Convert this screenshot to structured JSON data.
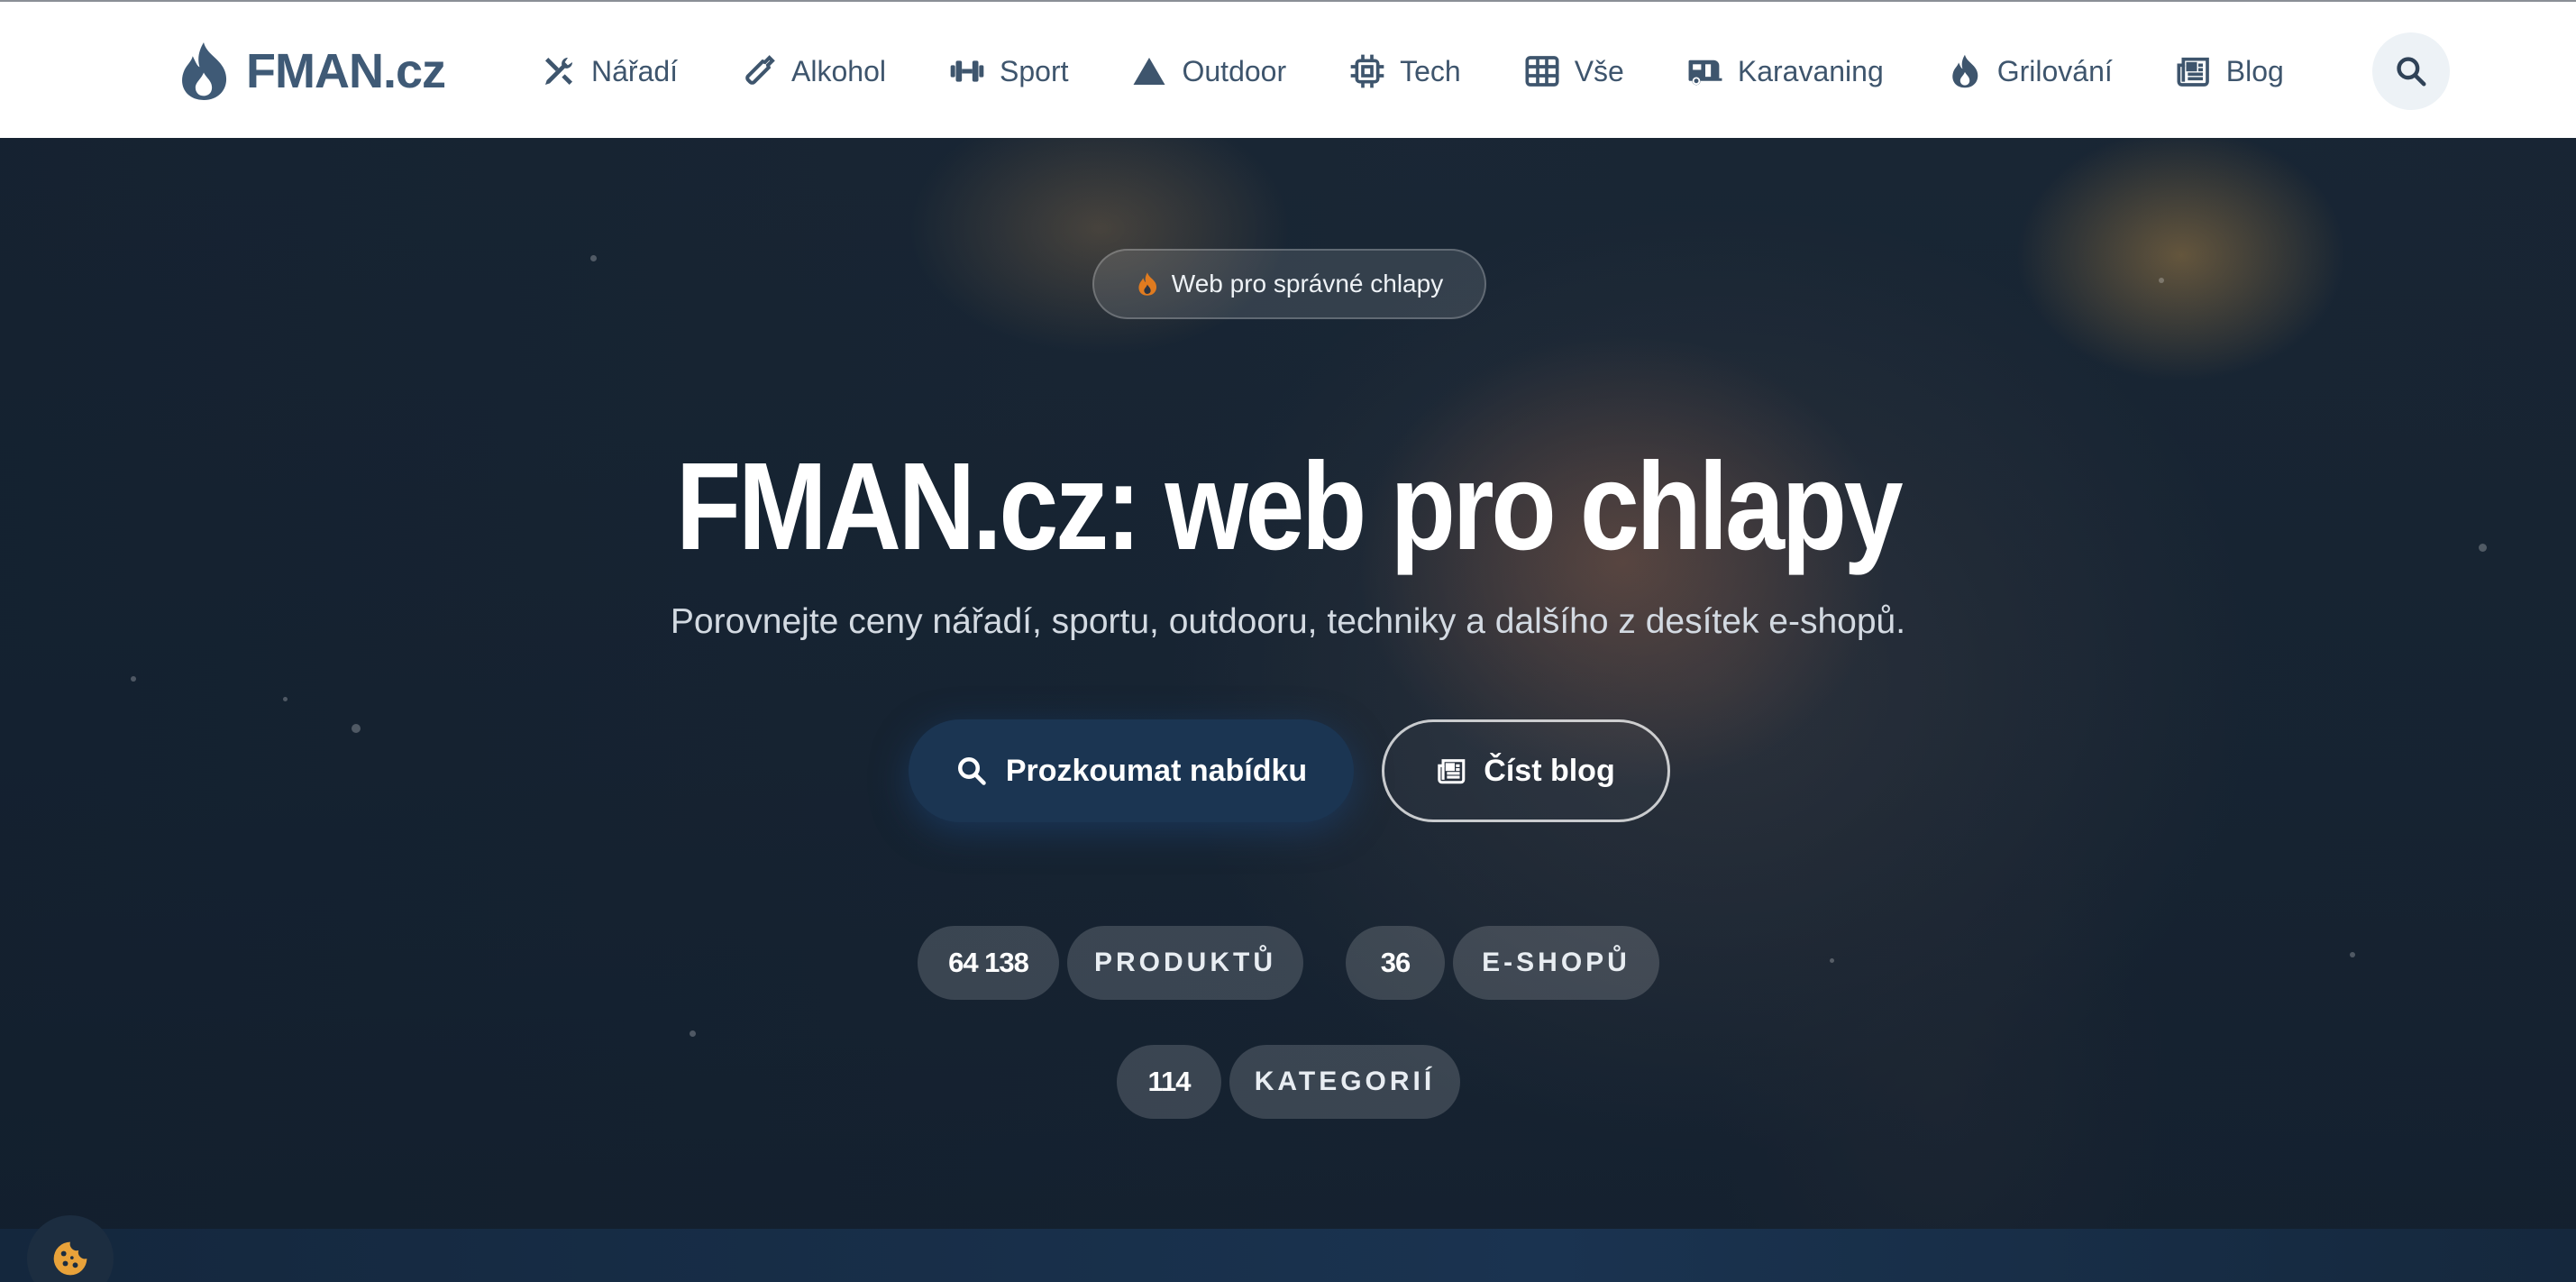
{
  "brand": {
    "name": "FMAN.cz",
    "logo_icon": "flame-icon",
    "color": "#3f5a76"
  },
  "nav": {
    "items": [
      {
        "label": "Nářadí",
        "icon": "tools-icon"
      },
      {
        "label": "Alkohol",
        "icon": "bottle-icon"
      },
      {
        "label": "Sport",
        "icon": "dumbbell-icon"
      },
      {
        "label": "Outdoor",
        "icon": "mountain-icon"
      },
      {
        "label": "Tech",
        "icon": "chip-icon"
      },
      {
        "label": "Vše",
        "icon": "grid-icon"
      },
      {
        "label": "Karavaning",
        "icon": "caravan-icon"
      },
      {
        "label": "Grilování",
        "icon": "flame-icon"
      },
      {
        "label": "Blog",
        "icon": "newspaper-icon"
      }
    ],
    "search_icon": "search-icon"
  },
  "hero": {
    "badge": "Web pro správné chlapy",
    "title": "FMAN.cz: web pro chlapy",
    "subtitle": "Porovnejte ceny nářadí, sportu, outdooru, techniky a dalšího z desítek e-shopů.",
    "primary_button": "Prozkoumat nabídku",
    "secondary_button": "Číst blog",
    "stats": [
      {
        "value": "64 138",
        "label": "PRODUKTŮ"
      },
      {
        "value": "36",
        "label": "E-SHOPŮ"
      },
      {
        "value": "114",
        "label": "KATEGORIÍ"
      }
    ]
  },
  "cookie_icon": "cookie-icon",
  "colors": {
    "accent": "#1b3552",
    "badge_flame": "#e07b1f",
    "cookie": "#e8a23a"
  }
}
